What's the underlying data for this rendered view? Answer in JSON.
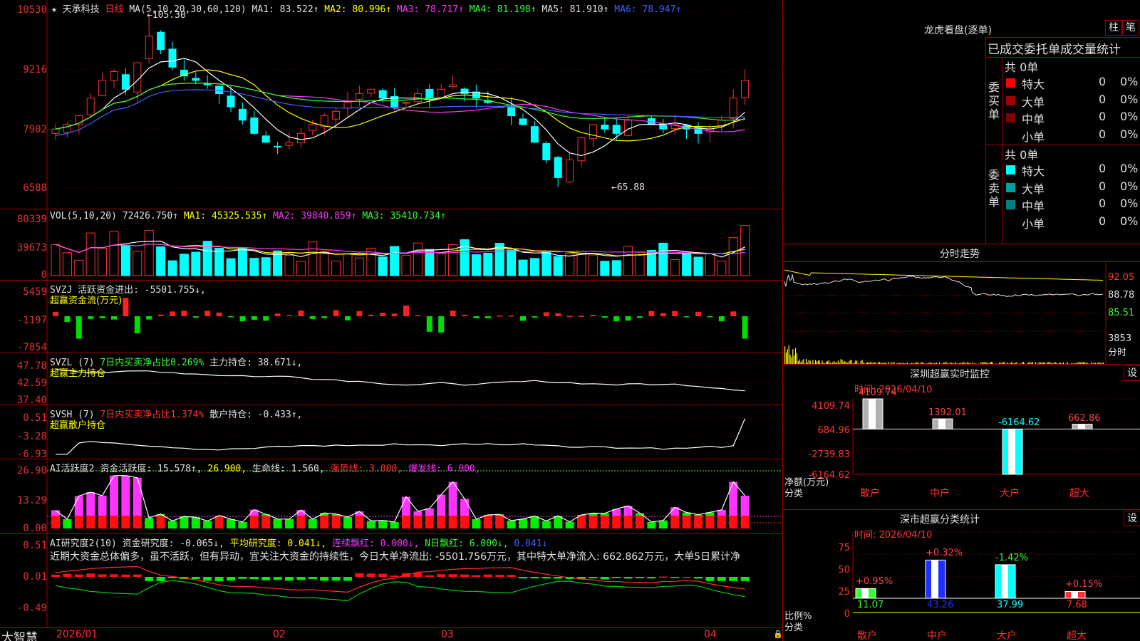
{
  "main": {
    "stock_name": "天承科技",
    "period": "日线",
    "ma_label": "MA(5,10,20,30,60,120)",
    "ma_values": [
      {
        "label": "MA1:",
        "value": "83.522↑",
        "color": "#e0e0e0"
      },
      {
        "label": "MA2:",
        "value": "80.996↑",
        "color": "#ffff00"
      },
      {
        "label": "MA3:",
        "value": "78.717↑",
        "color": "#ff33ff"
      },
      {
        "label": "MA4:",
        "value": "81.198↑",
        "color": "#33ff33"
      },
      {
        "label": "MA5:",
        "value": "81.910↑",
        "color": "#e0e0e0"
      },
      {
        "label": "MA6:",
        "value": "78.947↑",
        "color": "#4060ff"
      }
    ],
    "y_labels": [
      "10530",
      "9216",
      "7902",
      "6588"
    ],
    "high_marker": "105.30",
    "low_marker": "65.88"
  },
  "vol": {
    "label": "VOL(5,10,20)",
    "value": "72426.750↑",
    "ma1": "MA1: 45325.535↑",
    "ma2": "MA2: 39840.859↑",
    "ma3": "MA3: 35410.734↑",
    "y_labels": [
      "80339",
      "39673",
      "0"
    ]
  },
  "svzj": {
    "label": "SVZJ",
    "text": "活跃资金进出: -5501.755↓,",
    "subtitle": "超赢资金流(万元)",
    "y_labels": [
      "5459",
      "-1197",
      "-7854"
    ]
  },
  "svzl": {
    "label": "SVZL (7)",
    "text1": "7日内买卖净占比0.269%",
    "text2": "主力持仓: 38.671↓,",
    "subtitle": "超赢主力持仓",
    "y_labels": [
      "47.78",
      "42.59",
      "37.40"
    ]
  },
  "svsh": {
    "label": "SVSH (7)",
    "text1": "7日内买卖净占比1.374%",
    "text2": "散户持仓: -0.433↑,",
    "subtitle": "超赢散户持仓",
    "y_labels": [
      "0.51",
      "-3.28",
      "-6.93"
    ]
  },
  "ai1": {
    "label": "AI活跃度2",
    "text1": "资金活跃度: 15.578↑,",
    "text2": "26.900,",
    "text3": "生命线: 1.560,",
    "text4": "强势线: 3.000,",
    "text5": "爆发线: 6.000,",
    "y_labels": [
      "26.90",
      "13.29",
      "0.00"
    ]
  },
  "ai2": {
    "label": "AI研究度2(10)",
    "text1": "资金研究度: -0.065↓,",
    "text2": "平均研究度: 0.041↓,",
    "text3": "连续飘红: 0.000↓,",
    "text4": "N日飘红: 6.000↓,",
    "text5": "0.041↓",
    "comment": "近期大资金总体偏多，虽不活跃，但有异动，宜关注大资金的持续性，今日大单净流出: -5501.756万元，其中特大单净流入: 662.862万元，大单5日累计净",
    "y_labels": [
      "0.51",
      "0.01",
      "-0.49"
    ]
  },
  "xaxis": {
    "brand": "大智慧",
    "labels": [
      "2026/01",
      "02",
      "03",
      "04"
    ]
  },
  "right": {
    "lh_title": "龙虎看盘(逐单)",
    "btn1": "柱",
    "btn2": "笔",
    "stats_header": "已成交委托单成交量统计",
    "buy_label": "委买单",
    "sell_label": "委卖单",
    "buy_total": "共 0单",
    "sell_total": "共 0单",
    "buy_rows": [
      {
        "name": "特大",
        "v": "0",
        "p": "0%",
        "color": "#ff0000"
      },
      {
        "name": "大单",
        "v": "0",
        "p": "0%",
        "color": "#a00000"
      },
      {
        "name": "中单",
        "v": "0",
        "p": "0%",
        "color": "#800000"
      },
      {
        "name": "小单",
        "v": "0",
        "p": "0%",
        "color": "#000000"
      }
    ],
    "sell_rows": [
      {
        "name": "特大",
        "v": "0",
        "p": "0%",
        "color": "#00ffff"
      },
      {
        "name": "大单",
        "v": "0",
        "p": "0%",
        "color": "#00a0a0"
      },
      {
        "name": "中单",
        "v": "0",
        "p": "0%",
        "color": "#008080"
      },
      {
        "name": "小单",
        "v": "0",
        "p": "0%",
        "color": "#000000"
      }
    ],
    "intraday_title": "分时走势",
    "intraday_y": [
      "92.05",
      "88.78",
      "85.51",
      "3853"
    ],
    "intraday_unit": "分时",
    "sz_title": "深圳超赢实时监控",
    "settings": "设",
    "sz_time": "时间: 2026/04/10",
    "sz_y": [
      "4109.74",
      "684.96",
      "-2739.83",
      "-6164.62"
    ],
    "sz_ylabel": "净额(万元)",
    "sz_xlabel": "分类",
    "sz_bars": [
      {
        "cat": "散户",
        "val": 4109.74,
        "label": "4109.74"
      },
      {
        "cat": "中户",
        "val": 1392.01,
        "label": "1392.01"
      },
      {
        "cat": "大户",
        "val": -6164.62,
        "label": "-6164.62"
      },
      {
        "cat": "超大",
        "val": 662.86,
        "label": "662.86"
      }
    ],
    "fl_title": "深市超赢分类统计",
    "fl_time": "时间: 2026/04/10",
    "fl_y": [
      "75",
      "50",
      "25",
      "0"
    ],
    "fl_ylabel": "比例%",
    "fl_xlabel": "分类",
    "fl_bars": [
      {
        "cat": "散户",
        "val": 11.07,
        "label": "11.07",
        "chg": "+0.95%",
        "color": "#33ff33"
      },
      {
        "cat": "中户",
        "val": 43.26,
        "label": "43.26",
        "chg": "+0.32%",
        "color": "#2030ff"
      },
      {
        "cat": "大户",
        "val": 37.99,
        "label": "37.99",
        "chg": "-1.42%",
        "color": "#00ffff"
      },
      {
        "cat": "超大",
        "val": 7.68,
        "label": "7.68",
        "chg": "+0.15%",
        "color": "#ff3030"
      }
    ]
  }
}
